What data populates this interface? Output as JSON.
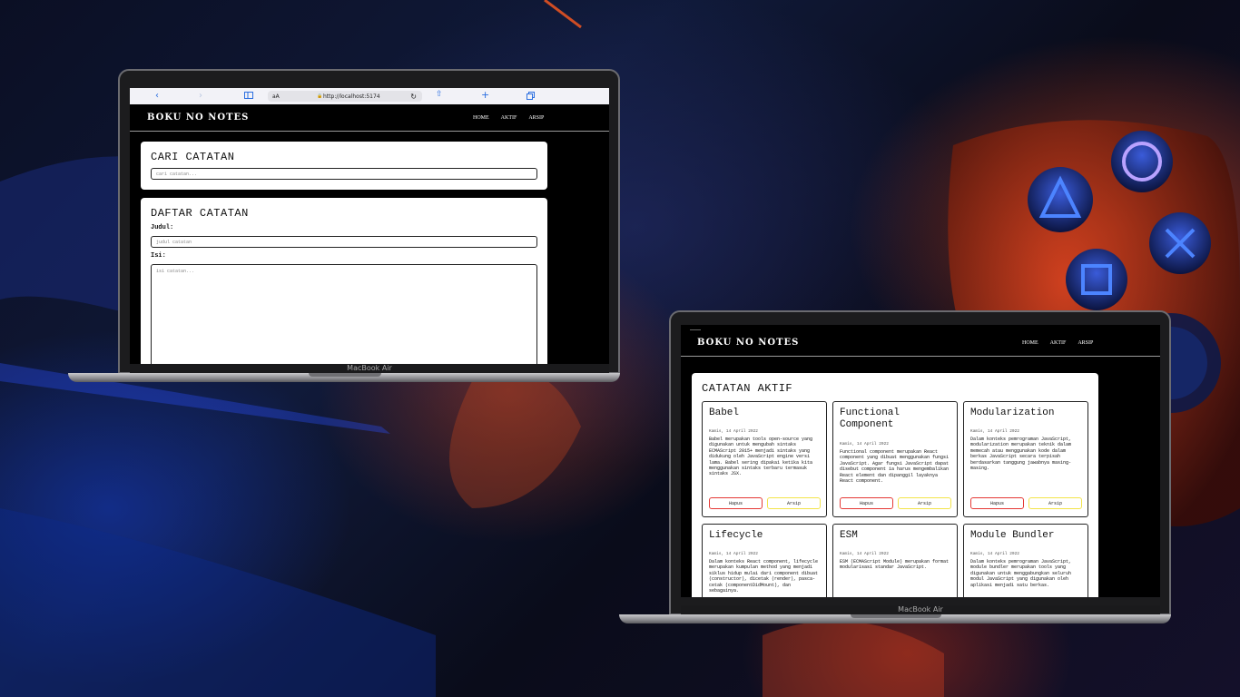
{
  "laptop_model": "MacBook Air",
  "browser": {
    "text_size": "aA",
    "url": "http://localhost:5174"
  },
  "app": {
    "brand": "BOKU NO NOTES",
    "nav": [
      "HOME",
      "AKTIF",
      "ARSIP"
    ]
  },
  "search": {
    "title": "CARI CATATAN",
    "placeholder": "cari catatan..."
  },
  "form": {
    "title": "DAFTAR CATATAN",
    "title_label": "Judul:",
    "title_placeholder": "judul catatan",
    "body_label": "Isi:",
    "body_placeholder": "isi catatan..."
  },
  "active": {
    "title": "CATATAN AKTIF",
    "delete_label": "Hapus",
    "archive_label": "Arsip",
    "notes": [
      {
        "title": "Babel",
        "date": "Kamis, 14 April 2022",
        "body": "Babel merupakan tools open-source yang digunakan untuk mengubah sintaks ECMAScript 2015+ menjadi sintaks yang didukung oleh JavaScript engine versi lama. Babel sering dipakai ketika kita menggunakan sintaks terbaru termasuk sintaks JSX."
      },
      {
        "title": "Functional Component",
        "date": "Kamis, 14 April 2022",
        "body": "Functional component merupakan React component yang dibuat menggunakan fungsi JavaScript. Agar fungsi JavaScript dapat disebut component ia harus mengembalikan React element dan dipanggil layaknya React component."
      },
      {
        "title": "Modularization",
        "date": "Kamis, 14 April 2022",
        "body": "Dalam konteks pemrograman JavaScript, modularization merupakan teknik dalam memecah atau menggunakan kode dalam berkas JavaScript secara terpisah berdasarkan tanggung jawabnya masing-masing."
      },
      {
        "title": "Lifecycle",
        "date": "Kamis, 14 April 2022",
        "body": "Dalam konteks React component, lifecycle merupakan kumpulan method yang menjadi siklus hidup mulai dari component dibuat (constructor), dicetak (render), pasca-cetak (componentDidMount), dan sebagainya."
      },
      {
        "title": "ESM",
        "date": "Kamis, 14 April 2022",
        "body": "ESM (ECMAScript Module) merupakan format modularisasi standar JavaScript."
      },
      {
        "title": "Module Bundler",
        "date": "Kamis, 14 April 2022",
        "body": "Dalam konteks pemrograman JavaScript, module bundler merupakan tools yang digunakan untuk menggabungkan seluruh modul JavaScript yang digunakan oleh aplikasi menjadi satu berkas."
      }
    ]
  },
  "icons": [
    "back-icon",
    "forward-icon",
    "sidebar-icon",
    "lock-icon",
    "reload-icon",
    "share-icon",
    "new-tab-icon",
    "tabs-icon"
  ]
}
